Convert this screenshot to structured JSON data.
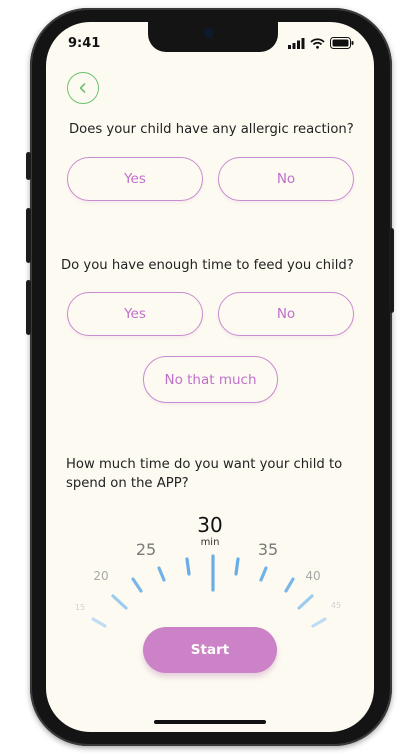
{
  "status_bar": {
    "time": "9:41"
  },
  "questions": [
    {
      "text": "Does your child have any allergic reaction?",
      "options": [
        "Yes",
        "No"
      ]
    },
    {
      "text": "Do you have enough time to feed you child?",
      "options": [
        "Yes",
        "No",
        "No that much"
      ]
    }
  ],
  "time_question": {
    "line1": "How much time do you want your child to",
    "line2": "spend on the APP?"
  },
  "dial": {
    "selected_value": "30",
    "unit": "min",
    "labels": [
      "15",
      "20",
      "25",
      "35",
      "40",
      "45"
    ]
  },
  "start_label": "Start",
  "colors": {
    "accent_purple": "#cc82c6",
    "pill_border": "#c98bd2",
    "back_green": "#6cc36e",
    "tick_blue": "#6aaee8",
    "background": "#fdfbf1"
  }
}
